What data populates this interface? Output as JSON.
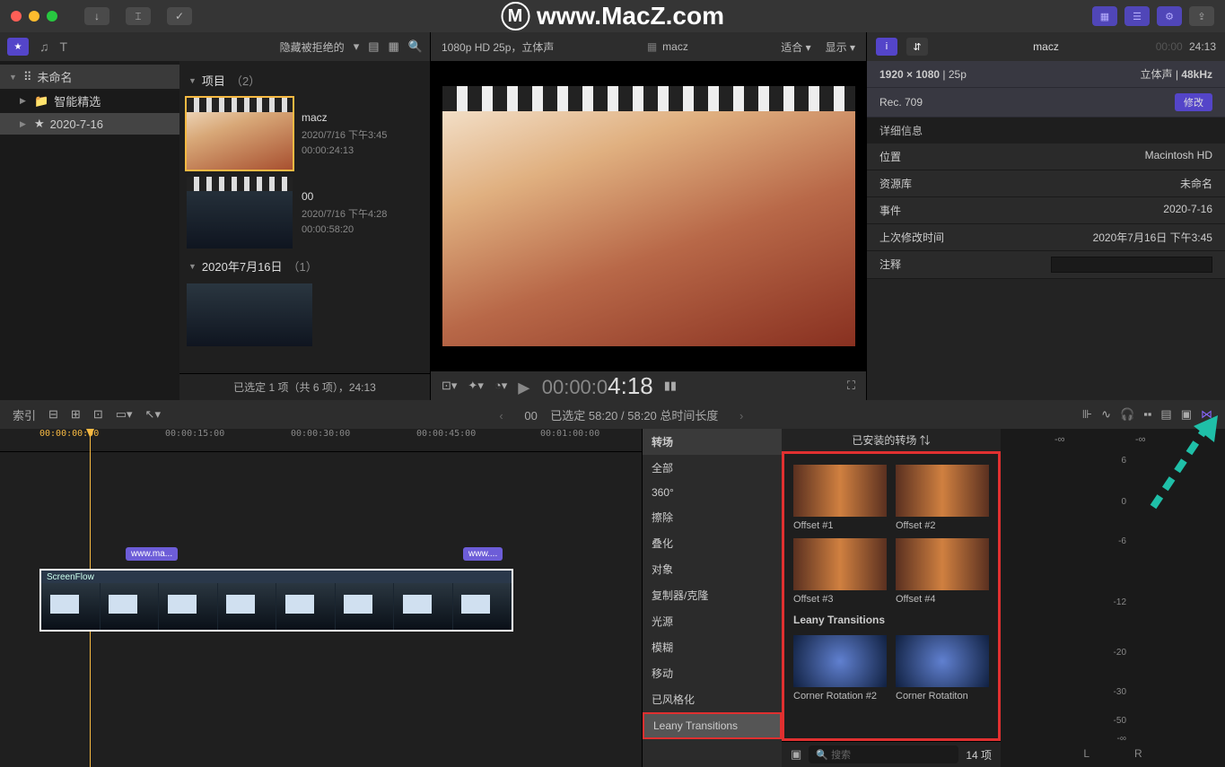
{
  "titlebar": {
    "watermark": "www.MacZ.com"
  },
  "library": {
    "filter": "隐藏被拒绝的",
    "header": "未命名",
    "items": [
      {
        "label": "智能精选",
        "icon": "folder"
      },
      {
        "label": "2020-7-16",
        "icon": "star"
      }
    ]
  },
  "browser": {
    "section1_label": "项目",
    "section1_count": "（2）",
    "projects": [
      {
        "name": "macz",
        "date": "2020/7/16 下午3:45",
        "duration": "00:00:24:13"
      },
      {
        "name": "00",
        "date": "2020/7/16 下午4:28",
        "duration": "00:00:58:20"
      }
    ],
    "section2_label": "2020年7月16日",
    "section2_count": "（1）",
    "footer": "已选定 1 项（共 6 项），24:13"
  },
  "viewer": {
    "format": "1080p HD 25p，立体声",
    "name": "macz",
    "fit": "适合",
    "display": "显示",
    "timecode_prefix": "00:00:0",
    "timecode_main": "4:18"
  },
  "inspector": {
    "title": "macz",
    "timecode_dim": "00:00",
    "timecode": "24:13",
    "resolution": "1920 × 1080",
    "fps": "25p",
    "audio": "立体声",
    "khz": "48kHz",
    "colorspace": "Rec. 709",
    "modify": "修改",
    "details_label": "详细信息",
    "rows": {
      "location_label": "位置",
      "location_value": "Macintosh HD",
      "library_label": "资源库",
      "library_value": "未命名",
      "event_label": "事件",
      "event_value": "2020-7-16",
      "modified_label": "上次修改时间",
      "modified_value": "2020年7月16日 下午3:45",
      "notes_label": "注释"
    }
  },
  "timelinebar": {
    "index": "索引",
    "center_name": "00",
    "center_sel": "已选定 58:20 / 58:20 总时间长度"
  },
  "timeline": {
    "ticks": [
      "00:00:00:00",
      "00:00:15:00",
      "00:00:30:00",
      "00:00:45:00",
      "00:01:00:00"
    ],
    "marker1": "www.ma...",
    "marker2": "www....",
    "clip_label": "ScreenFlow"
  },
  "transitions": {
    "header_label": "已安装的转场",
    "search_placeholder": "搜索",
    "count": "14 项",
    "categories": [
      "转场",
      "全部",
      "360°",
      "擦除",
      "叠化",
      "对象",
      "复制器/克隆",
      "光源",
      "模糊",
      "移动",
      "已风格化",
      "Leany Transitions"
    ],
    "section": "Leany Transitions",
    "items": [
      {
        "label": "Offset #1"
      },
      {
        "label": "Offset #2"
      },
      {
        "label": "Offset #3"
      },
      {
        "label": "Offset #4"
      },
      {
        "label": "Corner Rotation #2"
      },
      {
        "label": "Corner Rotatiton"
      }
    ]
  },
  "audio": {
    "dbs": [
      "6",
      "0",
      "-6",
      "-12",
      "-20",
      "-30",
      "-50",
      "-∞"
    ],
    "peak": "-∞",
    "left": "L",
    "right": "R"
  }
}
